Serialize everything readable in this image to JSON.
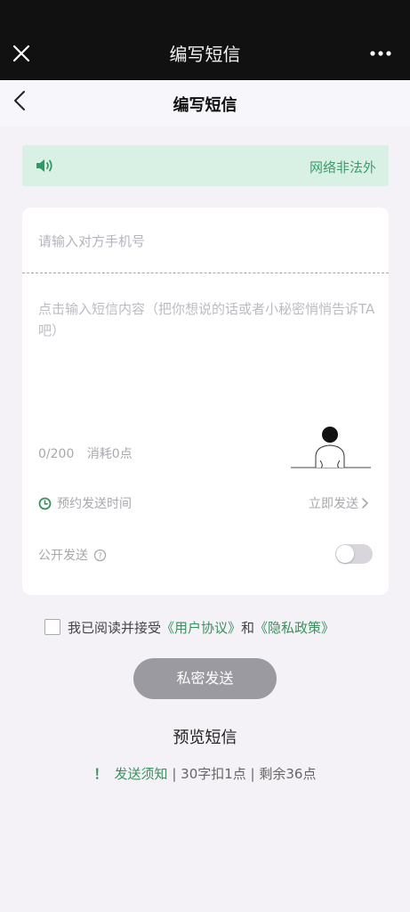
{
  "app_bar": {
    "title": "编写短信"
  },
  "nav": {
    "title": "编写短信"
  },
  "notice": {
    "text": "网络非法外"
  },
  "form": {
    "phone_placeholder": "请输入对方手机号",
    "message_placeholder": "点击输入短信内容（把你想说的话或者小秘密悄悄告诉TA吧）",
    "char_count": "0/200",
    "cost": "消耗0点",
    "schedule_label": "预约发送时间",
    "send_now_label": "立即发送",
    "public_label": "公开发送",
    "public_enabled": false
  },
  "agreement": {
    "prefix": "我已阅读并接受",
    "user_agreement": "《用户协议》",
    "and": "和",
    "privacy_policy": "《隐私政策》",
    "checked": false
  },
  "send_button": {
    "label": "私密发送"
  },
  "preview": {
    "label": "预览短信"
  },
  "rules": {
    "warn_mark": "！",
    "notice_link": "发送须知",
    "rate": "| 30字扣1点 | 剩余36点"
  },
  "colors": {
    "accent_green": "#3d8f5e",
    "notice_bg": "#d9f1e4",
    "button_gray": "#9b9aa0"
  }
}
